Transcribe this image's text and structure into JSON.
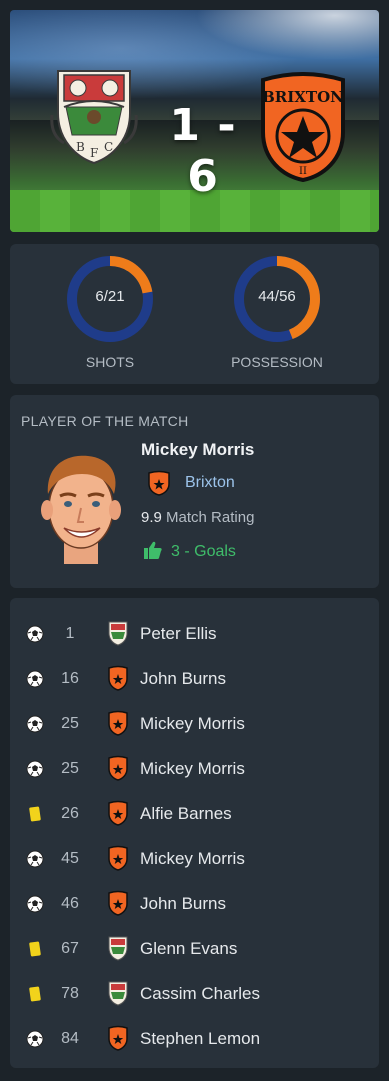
{
  "match": {
    "score": "1 - 6",
    "home_crest": "barnet-crest-icon",
    "away_crest": "brixton-crest-icon",
    "away_crest_text": "BRIXTON",
    "away_crest_sub": "II"
  },
  "stats": [
    {
      "label": "SHOTS",
      "value": "6/21",
      "home": 6,
      "away": 21,
      "home_color": "#ef7c1a",
      "away_color": "#1f3c8a"
    },
    {
      "label": "POSSESSION",
      "value": "44/56",
      "home": 44,
      "away": 56,
      "home_color": "#ef7c1a",
      "away_color": "#1f3c8a"
    }
  ],
  "potm": {
    "title": "PLAYER OF THE MATCH",
    "name": "Mickey Morris",
    "team": "Brixton",
    "rating": "9.9",
    "rating_label": "Match Rating",
    "goals_text": "3 - Goals",
    "goals_icon": "thumbs-up-icon"
  },
  "events": [
    {
      "type": "goal",
      "minute": "1",
      "team": "home",
      "player": "Peter Ellis"
    },
    {
      "type": "goal",
      "minute": "16",
      "team": "away",
      "player": "John Burns"
    },
    {
      "type": "goal",
      "minute": "25",
      "team": "away",
      "player": "Mickey Morris"
    },
    {
      "type": "goal",
      "minute": "25",
      "team": "away",
      "player": "Mickey Morris"
    },
    {
      "type": "yellow",
      "minute": "26",
      "team": "away",
      "player": "Alfie Barnes"
    },
    {
      "type": "goal",
      "minute": "45",
      "team": "away",
      "player": "Mickey Morris"
    },
    {
      "type": "goal",
      "minute": "46",
      "team": "away",
      "player": "John Burns"
    },
    {
      "type": "yellow",
      "minute": "67",
      "team": "home",
      "player": "Glenn Evans"
    },
    {
      "type": "yellow",
      "minute": "78",
      "team": "home",
      "player": "Cassim Charles"
    },
    {
      "type": "goal",
      "minute": "84",
      "team": "away",
      "player": "Stephen Lemon"
    }
  ],
  "colors": {
    "accent_orange": "#ef7c1a",
    "accent_blue": "#1f3c8a",
    "goals_green": "#3fbd6a",
    "team_link": "#9cc3ea",
    "yellow_card": "#f2d31b"
  }
}
